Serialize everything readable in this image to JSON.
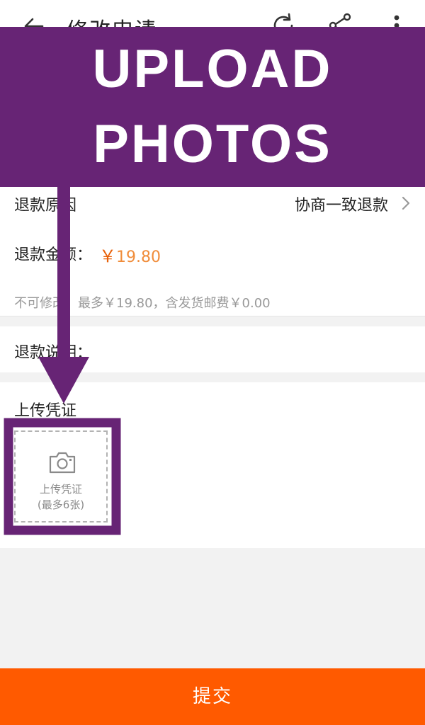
{
  "header": {
    "back_icon": "back-arrow-icon",
    "title": "修改申请",
    "refresh_icon": "refresh-icon",
    "share_icon": "share-icon",
    "more_icon": "more-vertical-icon"
  },
  "overlay": {
    "banner_line1": "UPLOAD",
    "banner_line2": "PHOTOS",
    "banner_color": "#672475"
  },
  "form": {
    "reason_label": "退款原因",
    "reason_value": "协商一致退款",
    "amount_label": "退款金额：",
    "amount_currency": "￥",
    "amount_value": "19.80",
    "amount_note": "不可修改，最多￥19.80，含发货邮费￥0.00",
    "description_label": "退款说明："
  },
  "upload": {
    "section_title": "上传凭证",
    "box_label": "上传凭证",
    "box_hint": "(最多6张)",
    "icon": "camera-icon"
  },
  "submit": {
    "label": "提交",
    "color": "#ff5a00"
  }
}
